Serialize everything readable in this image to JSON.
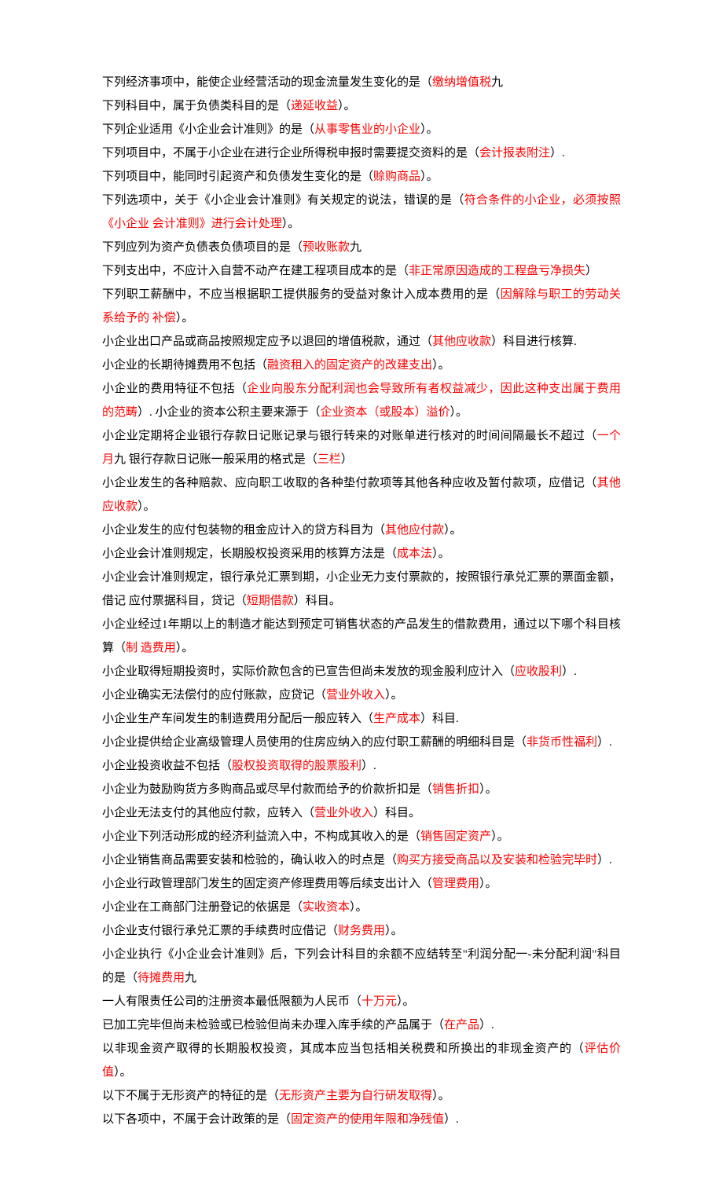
{
  "lines": [
    [
      {
        "t": "下列经济事项中，能使企业经营活动的现金流量发生变化的是（",
        "c": "blk"
      },
      {
        "t": "缴纳增值税",
        "c": "red"
      },
      {
        "t": "九",
        "c": "blk"
      }
    ],
    [
      {
        "t": "下列科目中，属于负债类科目的是（",
        "c": "blk"
      },
      {
        "t": "递延收益",
        "c": "red"
      },
      {
        "t": "）。",
        "c": "blk"
      }
    ],
    [
      {
        "t": "下列企业适用《小企业会计准则》的是（",
        "c": "blk"
      },
      {
        "t": "从事零售业的小企业",
        "c": "red"
      },
      {
        "t": "）。",
        "c": "blk"
      }
    ],
    [
      {
        "t": "下列项目中，不属于小企业在进行企业所得税申报时需要提交资料的是（",
        "c": "blk"
      },
      {
        "t": "会计报表附注",
        "c": "red"
      },
      {
        "t": "）.",
        "c": "blk"
      }
    ],
    [
      {
        "t": "下列项目中，能同时引起资产和负债发生变化的是（",
        "c": "blk"
      },
      {
        "t": "赊购商品",
        "c": "red"
      },
      {
        "t": "）。",
        "c": "blk"
      }
    ],
    [
      {
        "t": "下列选项中，关于《小企业会计准则》有关规定的说法，错误的是（",
        "c": "blk"
      },
      {
        "t": "符合条件的小企业，必须按照《小企业 会计准则》进行会计处理",
        "c": "red"
      },
      {
        "t": "）。",
        "c": "blk"
      }
    ],
    [
      {
        "t": "下列应列为资产负债表负债项目的是（",
        "c": "blk"
      },
      {
        "t": "预收账款",
        "c": "red"
      },
      {
        "t": "九",
        "c": "blk"
      }
    ],
    [
      {
        "t": "下列支出中，不应计入自营不动产在建工程项目成本的是（",
        "c": "blk"
      },
      {
        "t": "非正常原因造成的工程盘亏净损失",
        "c": "red"
      },
      {
        "t": "）",
        "c": "blk"
      }
    ],
    [
      {
        "t": "下列职工薪酬中，不应当根据职工提供服务的受益对象计入成本费用的是（",
        "c": "blk"
      },
      {
        "t": "因解除与职工的劳动关系给予的 补偿",
        "c": "red"
      },
      {
        "t": "）。",
        "c": "blk"
      }
    ],
    [
      {
        "t": "小企业出口产品或商品按照规定应予以退回的增值税款，通过（",
        "c": "blk"
      },
      {
        "t": "其他应收款",
        "c": "red"
      },
      {
        "t": "）科目进行核算.",
        "c": "blk"
      }
    ],
    [
      {
        "t": "小企业的长期待摊费用不包括（",
        "c": "blk"
      },
      {
        "t": "融资租入的固定资产的改建支出",
        "c": "red"
      },
      {
        "t": "）。",
        "c": "blk"
      }
    ],
    [
      {
        "t": "小企业的费用特征不包括（",
        "c": "blk"
      },
      {
        "t": "企业向股东分配利润也会导致所有者权益减少，因此这种支出属于费用的范畴",
        "c": "red"
      },
      {
        "t": "）. 小企业的资本公积主要来源于（",
        "c": "blk"
      },
      {
        "t": "企业资本（或股本）溢价",
        "c": "red"
      },
      {
        "t": "）。",
        "c": "blk"
      }
    ],
    [
      {
        "t": "小企业定期将企业银行存款日记账记录与银行转来的对账单进行核对的时间间隔最长不超过（",
        "c": "blk"
      },
      {
        "t": "一个月",
        "c": "red"
      },
      {
        "t": "九 银行存款日记账一般采用的格式是（",
        "c": "blk"
      },
      {
        "t": "三栏",
        "c": "red"
      },
      {
        "t": "）",
        "c": "blk"
      }
    ],
    [
      {
        "t": "小企业发生的各种赔款、应向职工收取的各种垫付款项等其他各种应收及暂付款项，应借记（",
        "c": "blk"
      },
      {
        "t": "其他应收款",
        "c": "red"
      },
      {
        "t": "）。",
        "c": "blk"
      }
    ],
    [
      {
        "t": "小企业发生的应付包装物的租金应计入的贷方科目为（",
        "c": "blk"
      },
      {
        "t": "其他应付款",
        "c": "red"
      },
      {
        "t": "）。",
        "c": "blk"
      }
    ],
    [
      {
        "t": "小企业会计准则规定，长期股权投资采用的核算方法是（",
        "c": "blk"
      },
      {
        "t": "成本法",
        "c": "red"
      },
      {
        "t": "）。",
        "c": "blk"
      }
    ],
    [
      {
        "t": "小企业会计准则规定，银行承兑汇票到期，小企业无力支付票款的，按照银行承兑汇票的票面金额，借记 应付票据科目，贷记（",
        "c": "blk"
      },
      {
        "t": "短期借款",
        "c": "red"
      },
      {
        "t": "）科目。",
        "c": "blk"
      }
    ],
    [
      {
        "t": "小企业经过1年期以上的制造才能达到预定可销售状态的产品发生的借款费用，通过以下哪个科目核算（",
        "c": "blk"
      },
      {
        "t": "制 造费用",
        "c": "red"
      },
      {
        "t": "）。",
        "c": "blk"
      }
    ],
    [
      {
        "t": "小企业取得短期投资时，实际价款包含的已宣告但尚未发放的现金股利应计入（",
        "c": "blk"
      },
      {
        "t": "应收股利",
        "c": "red"
      },
      {
        "t": "）.",
        "c": "blk"
      }
    ],
    [
      {
        "t": "小企业确实无法偿付的应付账款，应贷记（",
        "c": "blk"
      },
      {
        "t": "营业外收入",
        "c": "red"
      },
      {
        "t": "）。",
        "c": "blk"
      }
    ],
    [
      {
        "t": "小企业生产车间发生的制造费用分配后一般应转入（",
        "c": "blk"
      },
      {
        "t": "生产成本",
        "c": "red"
      },
      {
        "t": "）科目.",
        "c": "blk"
      }
    ],
    [
      {
        "t": "小企业提供给企业高级管理人员使用的住房应纳入的应付职工薪酬的明细科目是（",
        "c": "blk"
      },
      {
        "t": "非货币性福利",
        "c": "red"
      },
      {
        "t": "）.",
        "c": "blk"
      }
    ],
    [
      {
        "t": "小企业投资收益不包括（",
        "c": "blk"
      },
      {
        "t": "股权投资取得的股票股利",
        "c": "red"
      },
      {
        "t": "）.",
        "c": "blk"
      }
    ],
    [
      {
        "t": "小企业为鼓励购货方多购商品或尽早付款而给予的价款折扣是（",
        "c": "blk"
      },
      {
        "t": "销售折扣",
        "c": "red"
      },
      {
        "t": "）。",
        "c": "blk"
      }
    ],
    [
      {
        "t": "小企业无法支付的其他应付款，应转入（",
        "c": "blk"
      },
      {
        "t": "营业外收入",
        "c": "red"
      },
      {
        "t": "）科目。",
        "c": "blk"
      }
    ],
    [
      {
        "t": "小企业下列活动形成的经济利益流入中，不构成其收入的是（",
        "c": "blk"
      },
      {
        "t": "销售固定资产",
        "c": "red"
      },
      {
        "t": "）。",
        "c": "blk"
      }
    ],
    [
      {
        "t": "小企业销售商品需要安装和检验的，确认收入的时点是（",
        "c": "blk"
      },
      {
        "t": "购买方接受商品以及安装和检验完毕时",
        "c": "red"
      },
      {
        "t": "）.",
        "c": "blk"
      }
    ],
    [
      {
        "t": "小企业行政管理部门发生的固定资产修理费用等后续支出计入（",
        "c": "blk"
      },
      {
        "t": "管理费用",
        "c": "red"
      },
      {
        "t": "）。",
        "c": "blk"
      }
    ],
    [
      {
        "t": "小企业在工商部门注册登记的依据是（",
        "c": "blk"
      },
      {
        "t": "实收资本",
        "c": "red"
      },
      {
        "t": "）。",
        "c": "blk"
      }
    ],
    [
      {
        "t": "小企业支付银行承兑汇票的手续费时应借记（",
        "c": "blk"
      },
      {
        "t": "财务费用",
        "c": "red"
      },
      {
        "t": "）。",
        "c": "blk"
      }
    ],
    [
      {
        "t": "小企业执行《小企业会计准则》后，下列会计科目的余额不应结转至\"利润分配一-未分配利润\"科目的是（",
        "c": "blk"
      },
      {
        "t": "待摊费用",
        "c": "red"
      },
      {
        "t": "九",
        "c": "blk"
      }
    ],
    [
      {
        "t": "一人有限责任公司的注册资本最低限额为人民币（",
        "c": "blk"
      },
      {
        "t": "十万元",
        "c": "red"
      },
      {
        "t": "）。",
        "c": "blk"
      }
    ],
    [
      {
        "t": "已加工完毕但尚未检验或已检验但尚未办理入库手续的产品属于（",
        "c": "blk"
      },
      {
        "t": "在产品",
        "c": "red"
      },
      {
        "t": "）.",
        "c": "blk"
      }
    ],
    [
      {
        "t": "以非现金资产取得的长期股权投资，其成本应当包括相关税费和所换出的非现金资产的（",
        "c": "blk"
      },
      {
        "t": "评估价值",
        "c": "red"
      },
      {
        "t": "）。",
        "c": "blk"
      }
    ],
    [
      {
        "t": "以下不属于无形资产的特征的是（",
        "c": "blk"
      },
      {
        "t": "无形资产主要为自行研发取得",
        "c": "red"
      },
      {
        "t": "）。",
        "c": "blk"
      }
    ],
    [
      {
        "t": "以下各项中，不属于会计政策的是（",
        "c": "blk"
      },
      {
        "t": "固定资产的使用年限和净残值",
        "c": "red"
      },
      {
        "t": "）.",
        "c": "blk"
      }
    ]
  ]
}
